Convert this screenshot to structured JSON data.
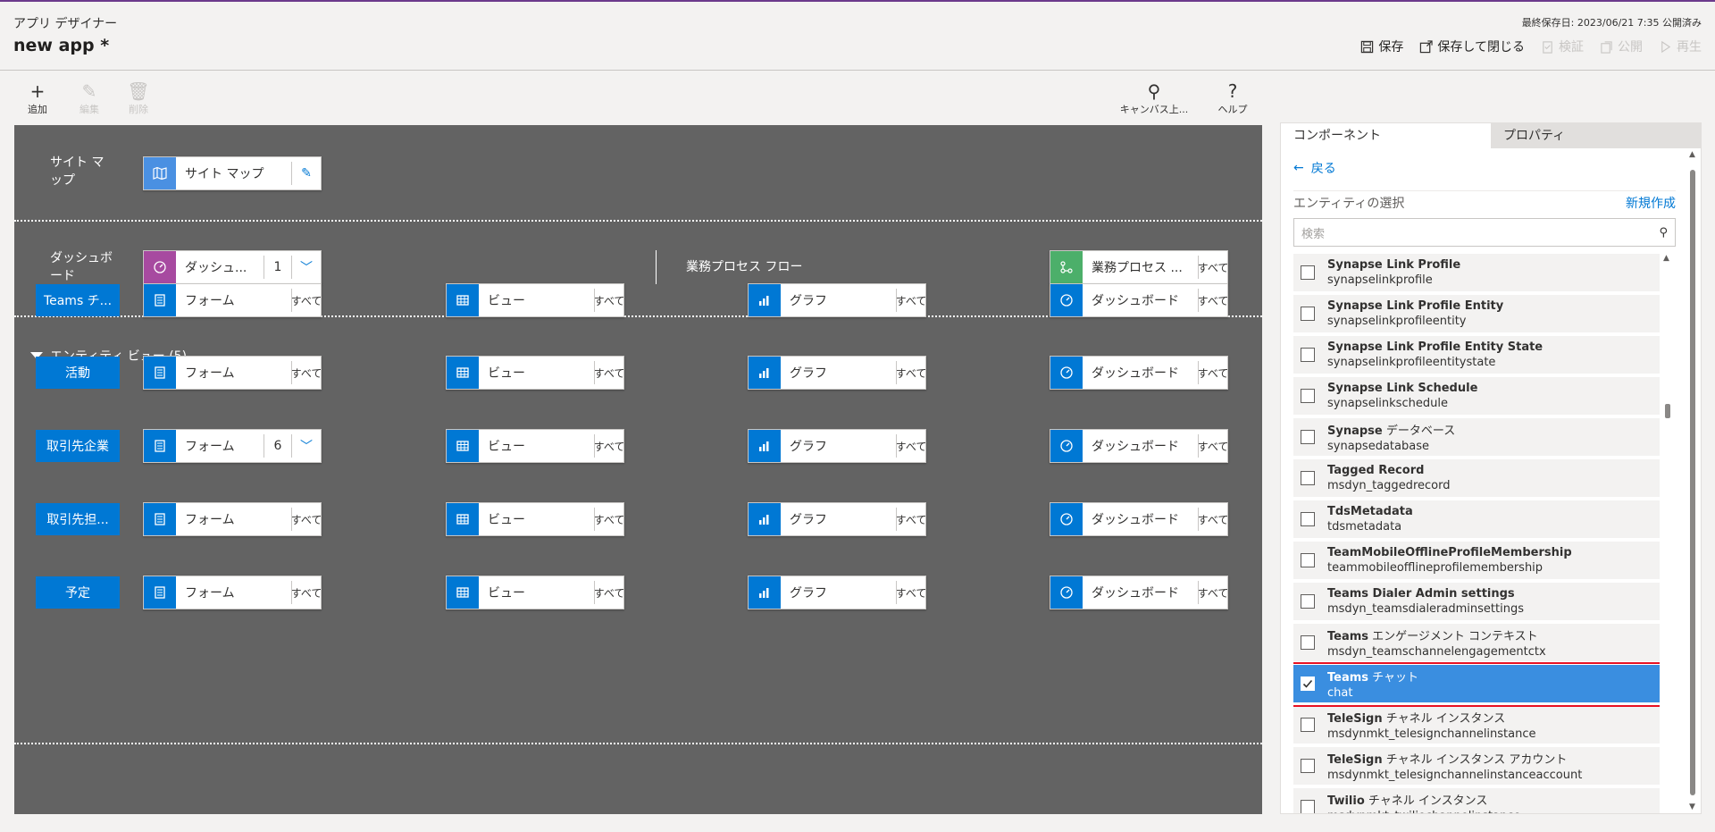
{
  "header": {
    "app_label": "アプリ デザイナー",
    "app_name": "new app *",
    "last_saved": "最終保存日: 2023/06/21 7:35 公開済み",
    "actions": {
      "save": "保存",
      "save_close": "保存して閉じる",
      "validate": "検証",
      "publish": "公開",
      "play": "再生"
    }
  },
  "toolbar": {
    "add": "追加",
    "edit": "編集",
    "delete": "削除",
    "canvas_search": "キャンバス上...",
    "help": "ヘルプ"
  },
  "canvas": {
    "sitemap": {
      "label": "サイト マップ",
      "tile": "サイト マップ"
    },
    "dashboard": {
      "label": "ダッシュボード",
      "tile": "ダッシュ...",
      "count": "1"
    },
    "bpf": {
      "label": "業務プロセス フロー",
      "tile": "業務プロセス ...",
      "all": "すべて"
    },
    "entity_section": "エンティティ ビュー (5)",
    "entities": [
      {
        "name": "Teams チ...",
        "form": "フォーム",
        "form_suffix": "すべて",
        "view": "ビュー",
        "view_suffix": "すべて",
        "chart": "グラフ",
        "chart_suffix": "すべて",
        "dash": "ダッシュボード",
        "dash_suffix": "すべて"
      },
      {
        "name": "活動",
        "form": "フォーム",
        "form_suffix": "すべて",
        "view": "ビュー",
        "view_suffix": "すべて",
        "chart": "グラフ",
        "chart_suffix": "すべて",
        "dash": "ダッシュボード",
        "dash_suffix": "すべて"
      },
      {
        "name": "取引先企業",
        "form": "フォーム",
        "form_count": "6",
        "view": "ビュー",
        "view_suffix": "すべて",
        "chart": "グラフ",
        "chart_suffix": "すべて",
        "dash": "ダッシュボード",
        "dash_suffix": "すべて"
      },
      {
        "name": "取引先担...",
        "form": "フォーム",
        "form_suffix": "すべて",
        "view": "ビュー",
        "view_suffix": "すべて",
        "chart": "グラフ",
        "chart_suffix": "すべて",
        "dash": "ダッシュボード",
        "dash_suffix": "すべて"
      },
      {
        "name": "予定",
        "form": "フォーム",
        "form_suffix": "すべて",
        "view": "ビュー",
        "view_suffix": "すべて",
        "chart": "グラフ",
        "chart_suffix": "すべて",
        "dash": "ダッシュボード",
        "dash_suffix": "すべて"
      }
    ]
  },
  "panel": {
    "tab_components": "コンポーネント",
    "tab_properties": "プロパティ",
    "back": "戻る",
    "select_entity": "エンティティの選択",
    "new": "新規作成",
    "search_placeholder": "検索",
    "entities": [
      {
        "name": "Synapse Link Profile",
        "name_jp": "",
        "logical": "synapselinkprofile",
        "checked": false
      },
      {
        "name": "Synapse Link Profile Entity",
        "name_jp": "",
        "logical": "synapselinkprofileentity",
        "checked": false
      },
      {
        "name": "Synapse Link Profile Entity State",
        "name_jp": "",
        "logical": "synapselinkprofileentitystate",
        "checked": false
      },
      {
        "name": "Synapse Link Schedule",
        "name_jp": "",
        "logical": "synapselinkschedule",
        "checked": false
      },
      {
        "name": "Synapse",
        "name_jp": " データベース",
        "logical": "synapsedatabase",
        "checked": false
      },
      {
        "name": "Tagged Record",
        "name_jp": "",
        "logical": "msdyn_taggedrecord",
        "checked": false
      },
      {
        "name": "TdsMetadata",
        "name_jp": "",
        "logical": "tdsmetadata",
        "checked": false
      },
      {
        "name": "TeamMobileOfflineProfileMembership",
        "name_jp": "",
        "logical": "teammobileofflineprofilemembership",
        "checked": false
      },
      {
        "name": "Teams Dialer Admin settings",
        "name_jp": "",
        "logical": "msdyn_teamsdialeradminsettings",
        "checked": false
      },
      {
        "name": "Teams",
        "name_jp": " エンゲージメント コンテキスト",
        "logical": "msdyn_teamschannelengagementctx",
        "checked": false
      },
      {
        "name": "Teams",
        "name_jp": " チャット",
        "logical": "chat",
        "checked": true
      },
      {
        "name": "TeleSign",
        "name_jp": " チャネル インスタンス",
        "logical": "msdynmkt_telesignchannelinstance",
        "checked": false
      },
      {
        "name": "TeleSign",
        "name_jp": " チャネル インスタンス アカウント",
        "logical": "msdynmkt_telesignchannelinstanceaccount",
        "checked": false
      },
      {
        "name": "Twilio",
        "name_jp": " チャネル インスタンス",
        "logical": "msdynmkt_twiliochannelinstance",
        "checked": false
      }
    ]
  }
}
